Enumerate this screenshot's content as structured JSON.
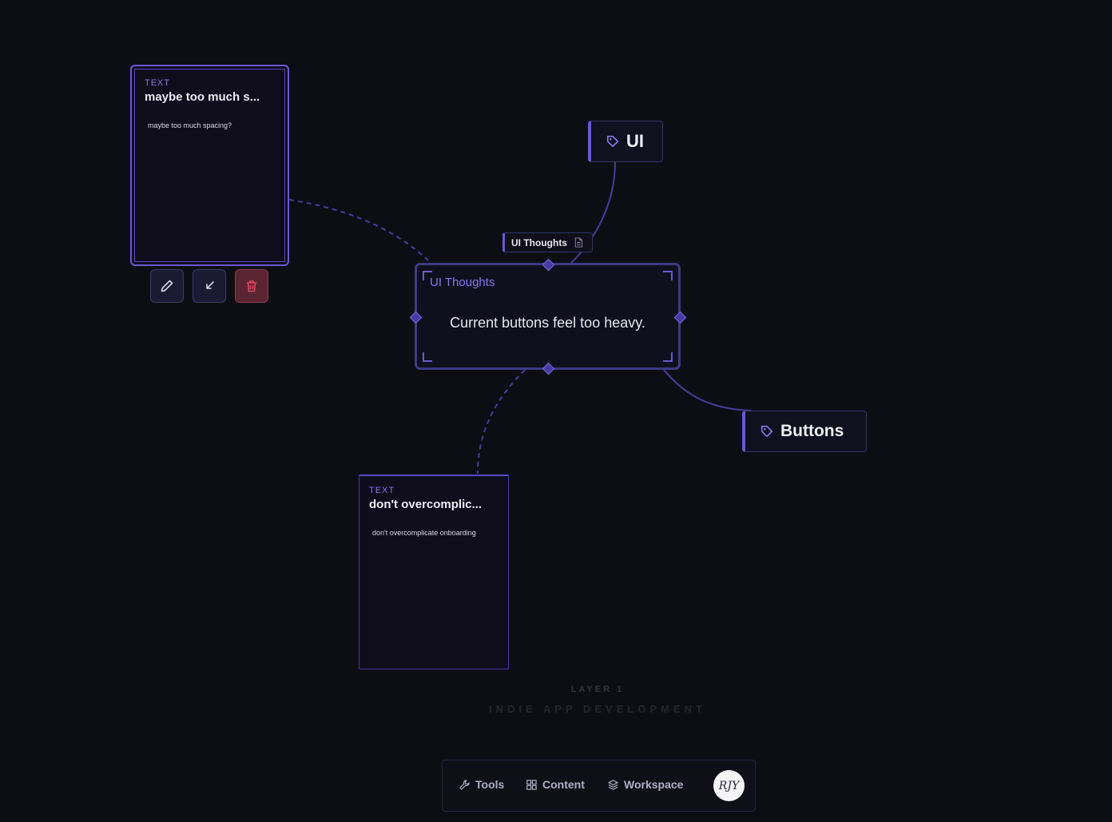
{
  "cards": [
    {
      "kind": "TEXT",
      "title": "maybe too much s...",
      "body": "maybe too much spacing?"
    },
    {
      "kind": "TEXT",
      "title": "don't overcomplic...",
      "body": "don't overcomplicate onboarding"
    }
  ],
  "card_actions": {
    "edit_icon": "pencil-icon",
    "reply_icon": "arrow-back-icon",
    "delete_icon": "trash-icon"
  },
  "note": {
    "label": "UI Thoughts",
    "label_icon": "document-icon",
    "title": "UI Thoughts",
    "text": "Current buttons feel too heavy."
  },
  "tags": [
    {
      "label": "UI",
      "icon": "tag-icon"
    },
    {
      "label": "Buttons",
      "icon": "tag-icon"
    }
  ],
  "layer": {
    "label": "LAYER 1",
    "name": "INDIE APP DEVELOPMENT"
  },
  "dock": {
    "items": [
      {
        "label": "Tools",
        "icon": "wrench-icon"
      },
      {
        "label": "Content",
        "icon": "grid-icon"
      },
      {
        "label": "Workspace",
        "icon": "layers-icon"
      }
    ],
    "avatar_initials": "RJY"
  },
  "colors": {
    "background": "#0d0e14",
    "accent": "#6b57d6",
    "danger": "#e0485e"
  }
}
